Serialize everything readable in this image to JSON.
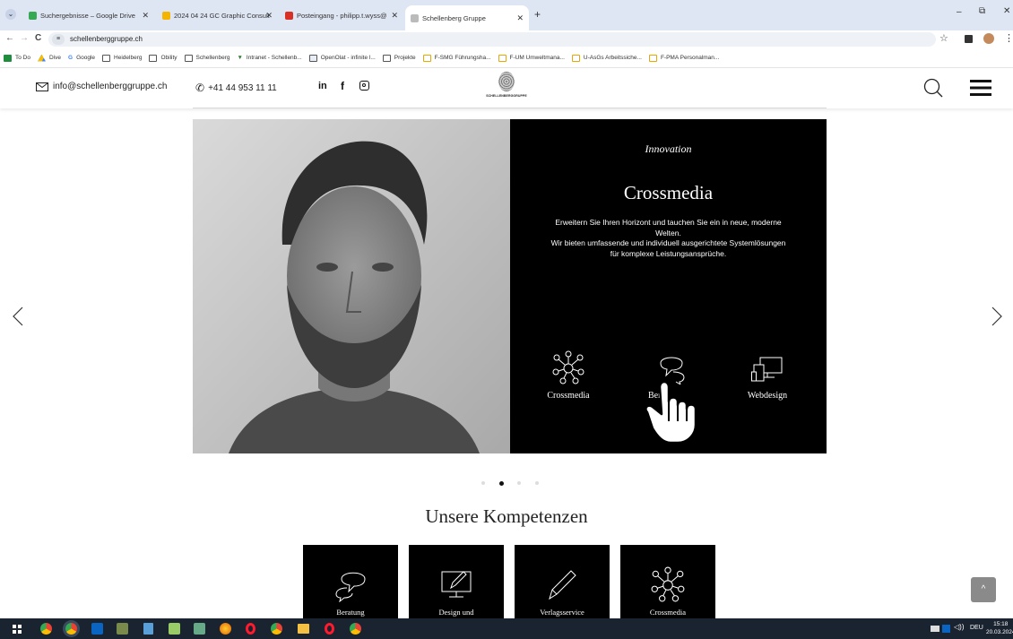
{
  "browser": {
    "tabs": [
      {
        "label": "Suchergebnisse – Google Drive",
        "color": "#34a853"
      },
      {
        "label": "2024 04 24 GC Graphic Consult",
        "color": "#f4b400"
      },
      {
        "label": "Posteingang - philipp.t.wyss@",
        "color": "#d93025"
      },
      {
        "label": "Schellenberg Gruppe",
        "color": "#999999"
      }
    ],
    "url": "schellenberggruppe.ch",
    "bookmarks": [
      "To Do",
      "Dive",
      "Google",
      "Heidelberg",
      "Obility",
      "Schellenberg",
      "Intranet - Schellenb...",
      "OpenOlat - infinite l...",
      "Projekte",
      "F-SMG Führungsha...",
      "F-UM Umweltmana...",
      "U-AsGs Arbeitssiche...",
      "F-PMA Personalman..."
    ]
  },
  "header": {
    "email": "info@schellenberggruppe.ch",
    "phone": "+41 44 953 11 11",
    "social": [
      "in",
      "f"
    ],
    "logo_text": "SCHELLENBERGGRUPPE"
  },
  "slide": {
    "kicker": "Innovation",
    "title": "Crossmedia",
    "text_line1": "Erweitern Sie Ihren Horizont und tauchen Sie ein in neue, moderne",
    "text_line2": "Welten.",
    "text_line3": "Wir bieten umfassende und individuell ausgerichtete Systemlösungen",
    "text_line4": "für komplexe Leistungsansprüche.",
    "icons": [
      {
        "label": "Crossmedia",
        "icon": "network-icon"
      },
      {
        "label": "Ber",
        "icon": "speech-bubbles-icon"
      },
      {
        "label": "Webdesign",
        "icon": "devices-icon"
      }
    ],
    "active_dot": 1,
    "dot_count": 4
  },
  "section": {
    "title": "Unsere Kompetenzen",
    "cards": [
      "Beratung",
      "Design und",
      "Verlagsservice",
      "Crossmedia"
    ]
  },
  "taskbar": {
    "lang": "DEU",
    "time": "15:18",
    "date": "20.03.2024"
  }
}
